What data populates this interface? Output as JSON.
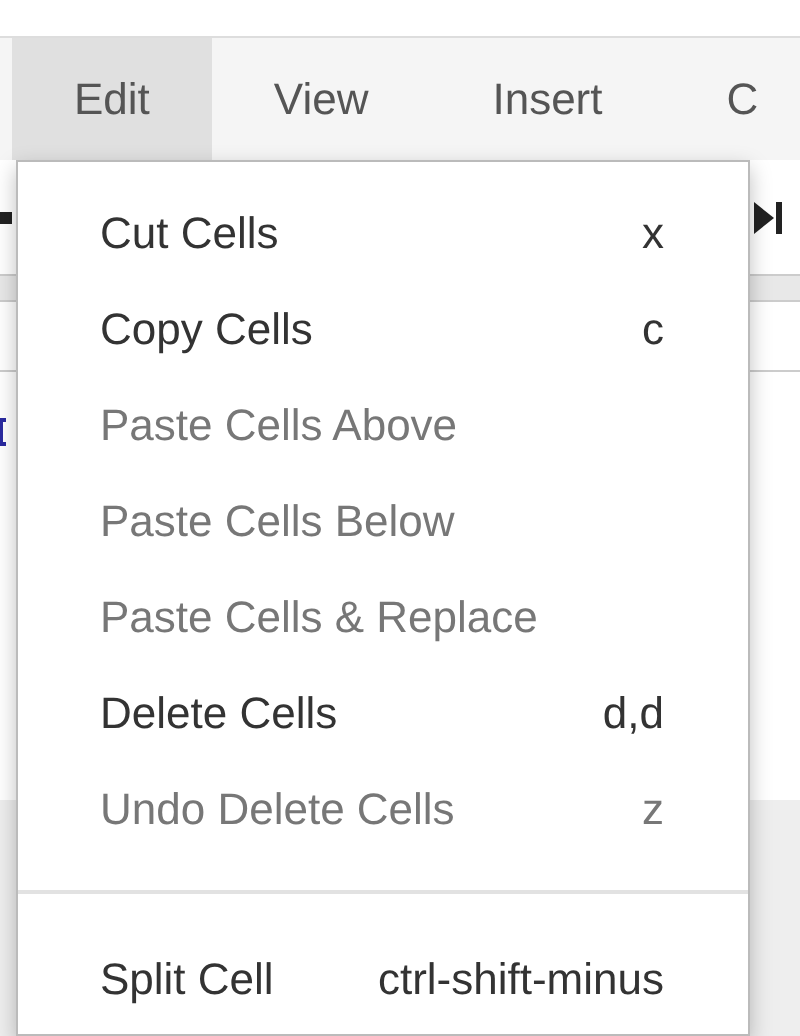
{
  "menubar": {
    "items": [
      {
        "label": "Edit",
        "selected": true
      },
      {
        "label": "View",
        "selected": false
      },
      {
        "label": "Insert",
        "selected": false
      },
      {
        "label": "C",
        "selected": false
      }
    ]
  },
  "edit_menu": {
    "items": [
      {
        "kind": "item",
        "label": "Cut Cells",
        "shortcut": "x",
        "disabled": false
      },
      {
        "kind": "item",
        "label": "Copy Cells",
        "shortcut": "c",
        "disabled": false
      },
      {
        "kind": "item",
        "label": "Paste Cells Above",
        "disabled": true
      },
      {
        "kind": "item",
        "label": "Paste Cells Below",
        "disabled": true
      },
      {
        "kind": "item",
        "label": "Paste Cells & Replace",
        "disabled": true
      },
      {
        "kind": "item",
        "label": "Delete Cells",
        "shortcut": "d,d",
        "disabled": false
      },
      {
        "kind": "item",
        "label": "Undo Delete Cells",
        "shortcut": "z",
        "disabled": true
      },
      {
        "kind": "divider"
      },
      {
        "kind": "item",
        "label": "Split Cell",
        "shortcut": "ctrl-shift-minus",
        "disabled": false
      }
    ]
  }
}
